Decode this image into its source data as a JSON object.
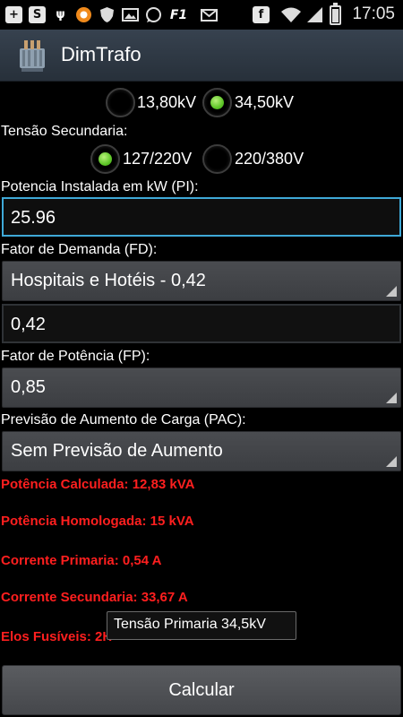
{
  "status_bar": {
    "time": "17:05",
    "icons": [
      "add-icon",
      "skype-icon",
      "usb-icon",
      "avast-icon",
      "shield-icon",
      "image-icon",
      "whatsapp-icon",
      "f1-icon",
      "email-icon",
      "facebook-icon",
      "wifi-icon",
      "signal-icon",
      "battery-icon"
    ],
    "battery_level": 0.85
  },
  "action_bar": {
    "title": "DimTrafo",
    "icon": "transformer-icon"
  },
  "form": {
    "primary_voltage": {
      "options": [
        "13,80kV",
        "34,50kV"
      ],
      "selected": "34,50kV"
    },
    "secondary_voltage": {
      "label": "Tensão Secundaria:",
      "options": [
        "127/220V",
        "220/380V"
      ],
      "selected": "127/220V"
    },
    "installed_power": {
      "label": "Potencia Instalada em kW (PI):",
      "value": "25.96"
    },
    "demand_factor": {
      "label": "Fator de Demanda (FD):",
      "selected": "Hospitais e Hotéis - 0,42",
      "value": "0,42"
    },
    "power_factor": {
      "label": "Fator de Potência (FP):",
      "selected": "0,85"
    },
    "load_increase": {
      "label": "Previsão de Aumento de Carga (PAC):",
      "selected": "Sem Previsão de Aumento"
    }
  },
  "results": {
    "calculated_power": "Potência Calculada: 12,83 kVA",
    "approved_power": "Potência Homologada: 15 kVA",
    "primary_current": "Corrente Primaria: 0,54 A",
    "secondary_current": "Corrente Secundaria: 33,67 A",
    "fuses": "Elos Fusíveis: 2H"
  },
  "toast": "Tensão Primaria 34,5kV",
  "calculate_button": "Calcular",
  "colors": {
    "result_text": "#ff1f1f",
    "focus_border": "#3fa9d8",
    "radio_selected": "#5ec628"
  }
}
